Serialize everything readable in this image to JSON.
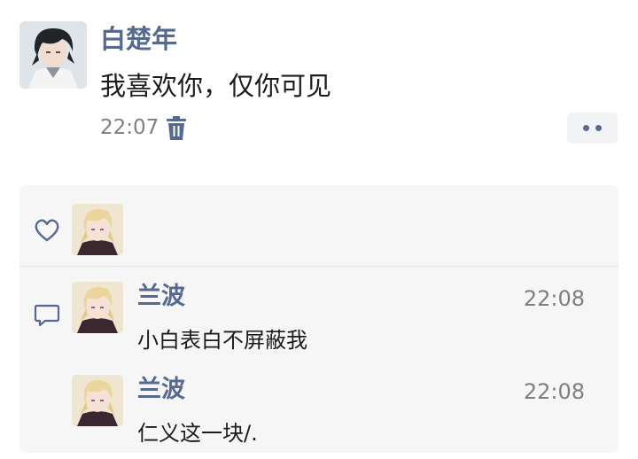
{
  "post": {
    "author": "白楚年",
    "text": "我喜欢你，仅你可见",
    "time": "22:07",
    "avatar_icon": "profile-avatar-dark-hair",
    "delete_icon": "trash-icon",
    "more_icon": "more-dots-icon"
  },
  "likes": {
    "icon": "heart-icon",
    "users": [
      {
        "avatar_icon": "profile-avatar-blond-hair"
      }
    ]
  },
  "comments_section": {
    "icon": "comment-bubble-icon",
    "items": [
      {
        "author": "兰波",
        "time": "22:08",
        "text": "小白表白不屏蔽我"
      },
      {
        "author": "兰波",
        "time": "22:08",
        "text": "仁义这一块/."
      }
    ]
  },
  "colors": {
    "name_link": "#56698f",
    "body_text": "#1c1c1c",
    "meta_text": "#7f7f7f",
    "panel_bg": "#f6f6f6",
    "more_button_bg": "#f2f3f5"
  }
}
